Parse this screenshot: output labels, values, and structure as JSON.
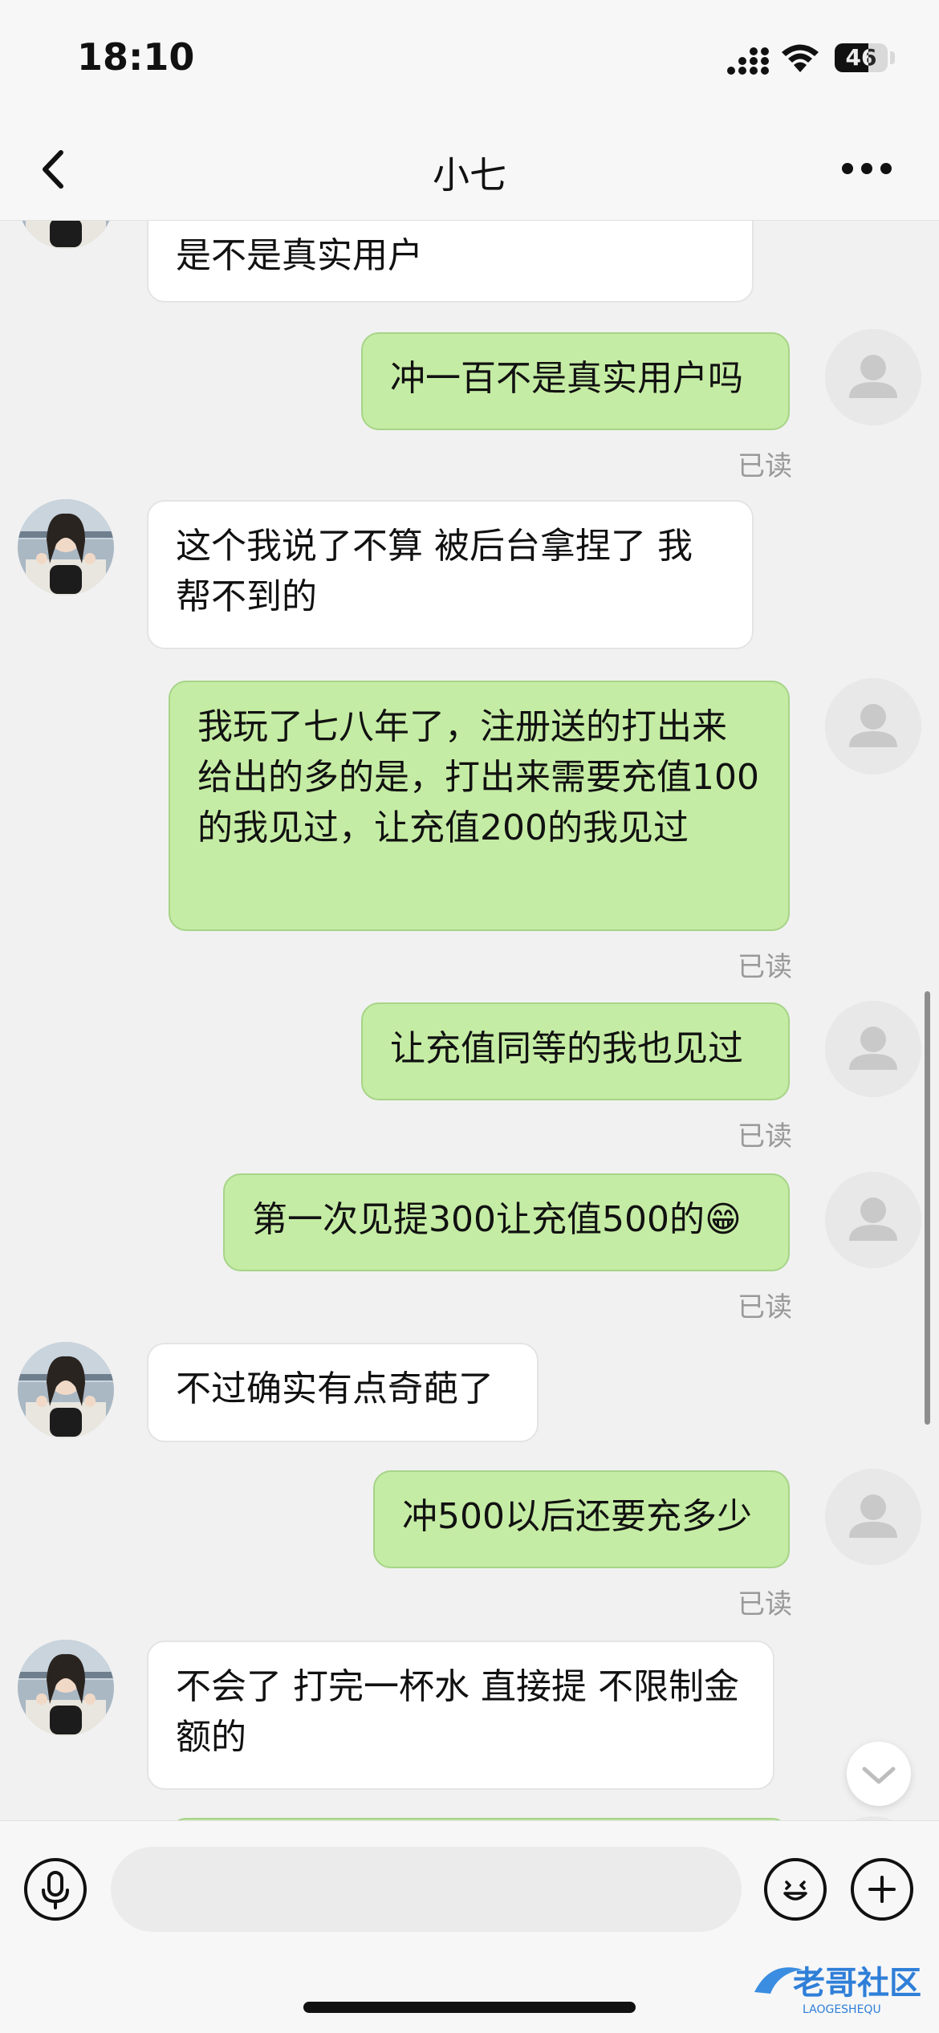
{
  "status_bar": {
    "time": "18:10",
    "battery": "46"
  },
  "nav": {
    "title": "小七"
  },
  "messages": [
    {
      "side": "in",
      "text": "是不是真实用户"
    },
    {
      "side": "out",
      "text": "冲一百不是真实用户吗",
      "status": "已读"
    },
    {
      "side": "in",
      "text": "这个我说了不算 被后台拿捏了 我帮不到的"
    },
    {
      "side": "out",
      "text": "我玩了七八年了，注册送的打出来给出的多的是，打出来需要充值100的我见过，让充值200的我见过",
      "status": "已读"
    },
    {
      "side": "out",
      "text": "让充值同等的我也见过",
      "status": "已读"
    },
    {
      "side": "out",
      "text": "第一次见提300让充值500的😁",
      "status": "已读"
    },
    {
      "side": "in",
      "text": "不过确实有点奇葩了"
    },
    {
      "side": "out",
      "text": "冲500以后还要充多少",
      "status": "已读"
    },
    {
      "side": "in",
      "text": "不会了  打完一杯水 直接提 不限制金额的"
    }
  ],
  "input": {
    "placeholder": ""
  },
  "watermark": {
    "cn": "老哥社区",
    "en": "LAOGESHEQU"
  },
  "colors": {
    "outgoing_bubble": "#c5eca4",
    "incoming_bubble": "#ffffff",
    "background": "#f1f1f1"
  }
}
